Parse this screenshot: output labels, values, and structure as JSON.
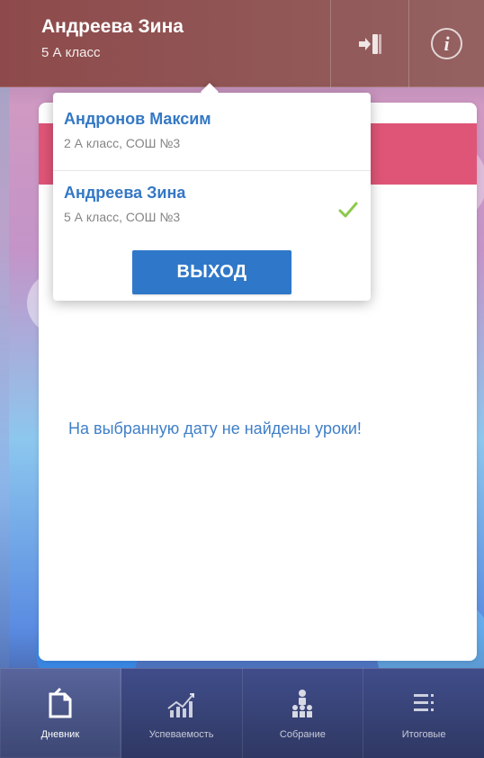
{
  "header": {
    "name": "Андреева Зина",
    "class_label": "5 А класс"
  },
  "popup": {
    "profiles": [
      {
        "name": "Андронов Максим",
        "details": "2 А класс, СОШ №3",
        "selected": false
      },
      {
        "name": "Андреева Зина",
        "details": "5 А класс, СОШ №3",
        "selected": true
      }
    ],
    "logout_label": "ВЫХОД"
  },
  "main": {
    "empty_message": "На выбранную дату не найдены уроки!"
  },
  "bottom_nav": {
    "items": [
      {
        "label": "Дневник",
        "icon": "diary-icon",
        "active": true
      },
      {
        "label": "Успеваемость",
        "icon": "progress-chart-icon",
        "active": false
      },
      {
        "label": "Собрание",
        "icon": "meeting-icon",
        "active": false
      },
      {
        "label": "Итоговые",
        "icon": "final-results-icon",
        "active": false
      }
    ]
  },
  "colors": {
    "header_bg": "#915656",
    "accent_red": "#df5577",
    "primary_blue": "#2f78c9",
    "text_blue": "#3478c4",
    "nav_bg": "#333d6e",
    "success_green": "#8cc94d"
  }
}
